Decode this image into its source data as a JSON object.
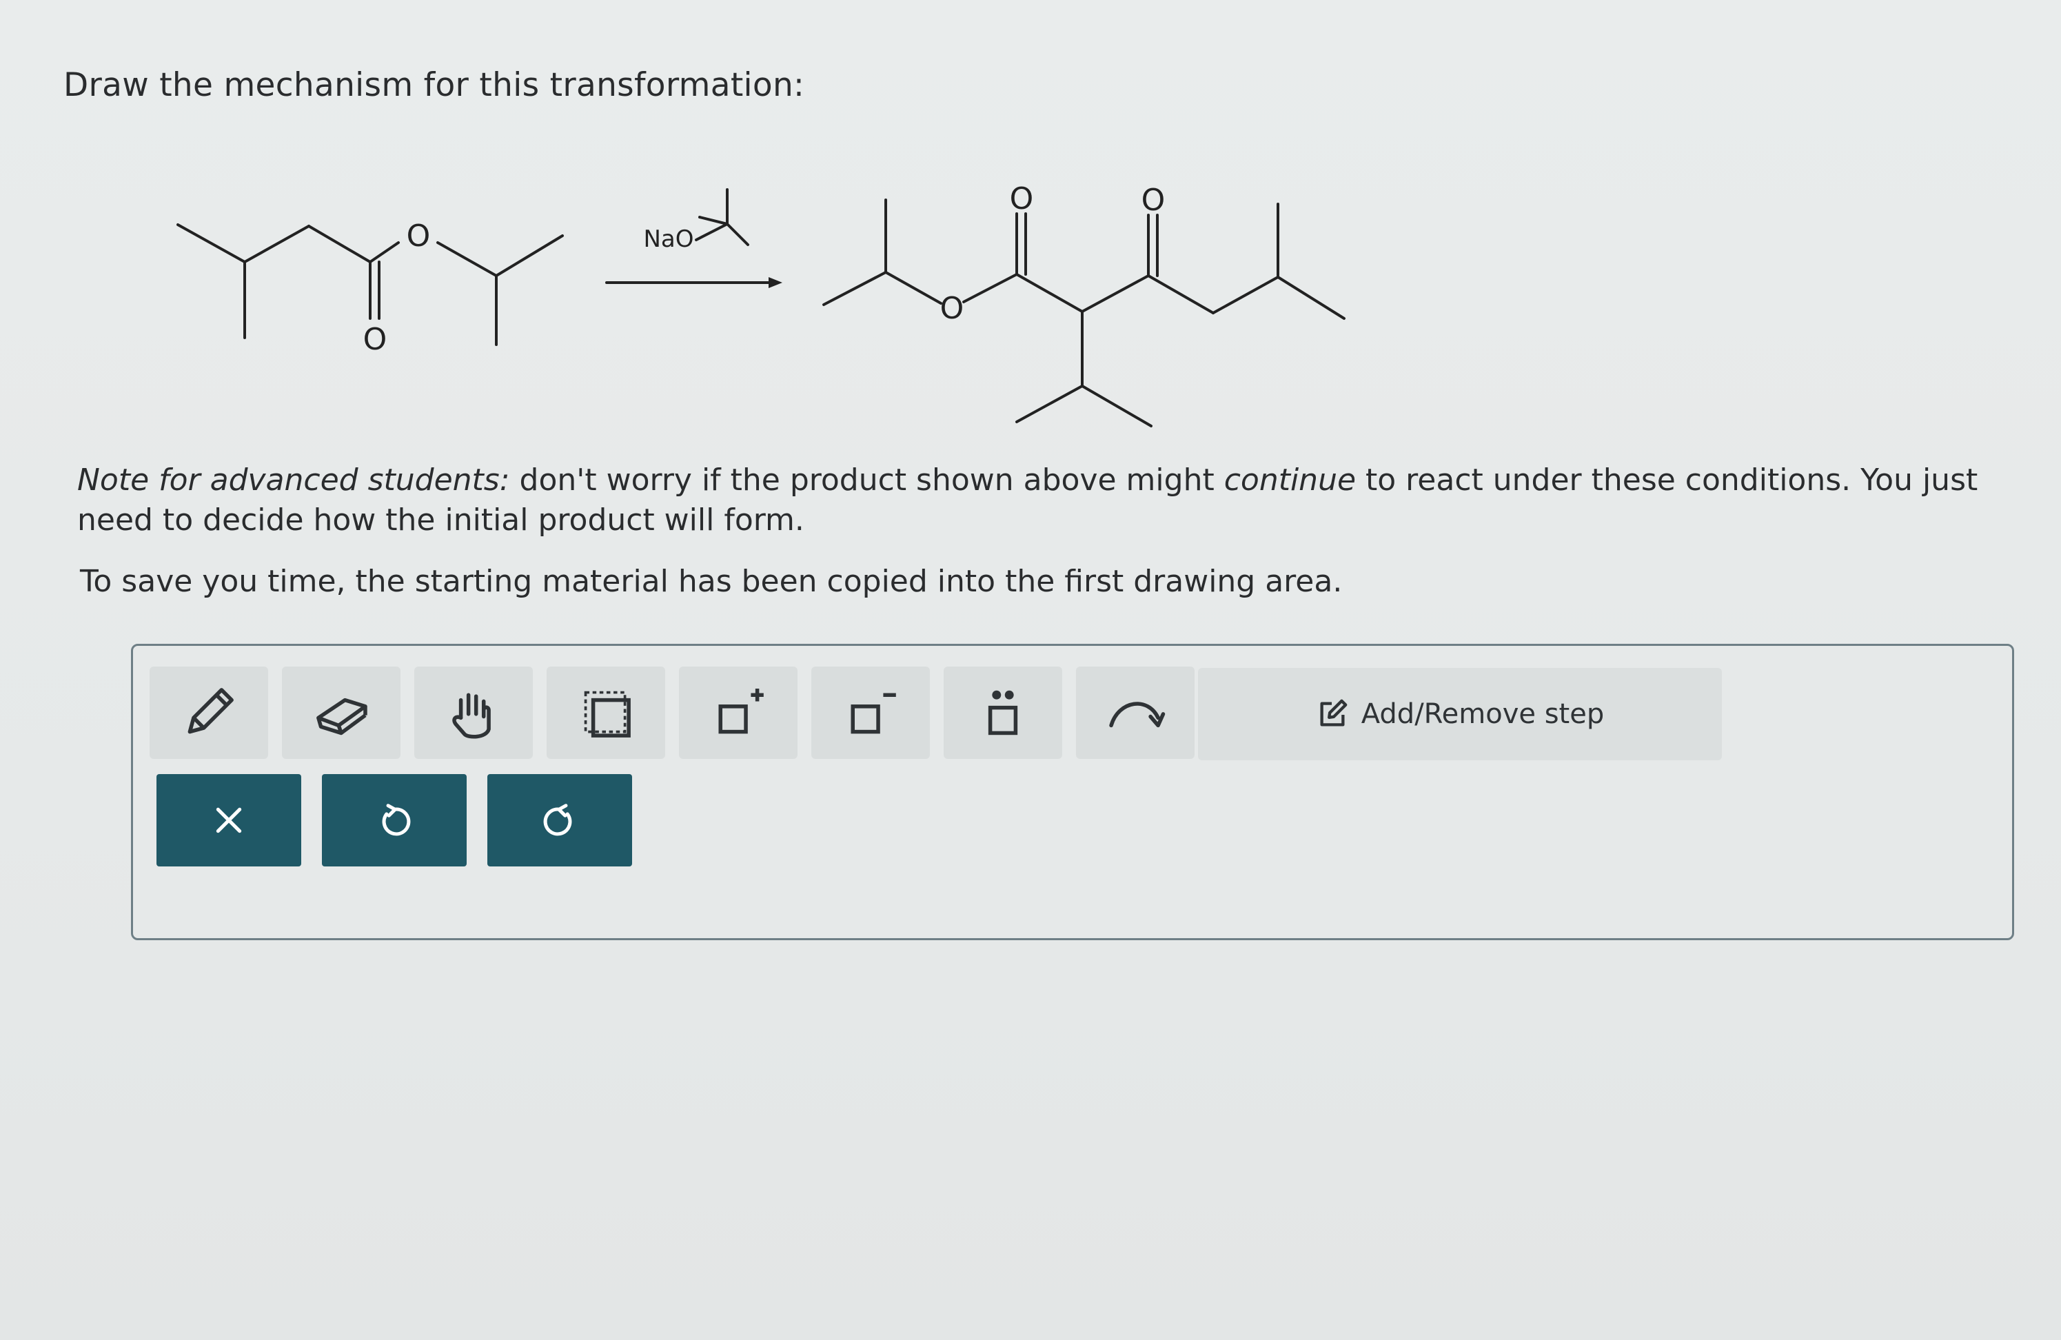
{
  "question": {
    "heading": "Draw the mechanism for this transformation:"
  },
  "reaction": {
    "reagent_label": "NaO",
    "atom_label": "O"
  },
  "note": {
    "lead": "Note for advanced students:",
    "part1": " don't worry if the product shown above might ",
    "emphasis": "continue",
    "part2": " to react under these conditions. You just need to decide how the initial product will form."
  },
  "copy_note": "To save you time, the starting material has been copied into the first drawing area.",
  "toolbar": {
    "tools": [
      {
        "name": "pencil-icon"
      },
      {
        "name": "eraser-icon"
      },
      {
        "name": "hand-icon"
      },
      {
        "name": "select-box-icon"
      },
      {
        "name": "positive-charge-icon"
      },
      {
        "name": "negative-charge-icon"
      },
      {
        "name": "lone-pair-icon"
      },
      {
        "name": "curved-arrow-icon"
      }
    ],
    "add_remove_label": "Add/Remove step",
    "actions": [
      {
        "name": "clear-button",
        "icon": "close-icon"
      },
      {
        "name": "undo-button",
        "icon": "undo-icon"
      },
      {
        "name": "redo-button",
        "icon": "redo-icon"
      }
    ]
  },
  "colors": {
    "action_button": "#1f5866",
    "panel_border": "#6e7f86"
  }
}
